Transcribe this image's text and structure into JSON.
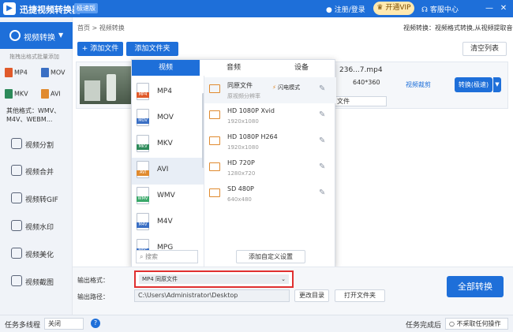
{
  "titlebar": {
    "app_title": "迅捷视频转换器",
    "edition_badge": "极速版",
    "login": "注册/登录",
    "vip": "开通VIP",
    "service": "客服中心",
    "minimize": "—",
    "close": "✕"
  },
  "sidebar": {
    "active_label": "视频转换",
    "hint": "拖拽出格式批量添加",
    "formats": [
      {
        "label": "MP4",
        "color": "#e05a2b"
      },
      {
        "label": "MOV",
        "color": "#3a6fc4"
      },
      {
        "label": "MKV",
        "color": "#2d8a5a"
      },
      {
        "label": "AVI",
        "color": "#e08a2e"
      }
    ],
    "others": "其他格式：WMV、M4V、WEBM...",
    "items": [
      {
        "label": "视频分割",
        "icon": "split-icon"
      },
      {
        "label": "视频合并",
        "icon": "merge-icon"
      },
      {
        "label": "视频转GIF",
        "icon": "gif-icon"
      },
      {
        "label": "视频水印",
        "icon": "watermark-icon"
      },
      {
        "label": "视频美化",
        "icon": "beautify-icon"
      },
      {
        "label": "视频截图",
        "icon": "screenshot-icon"
      }
    ]
  },
  "breadcrumb": "首页 > 视频转换",
  "top_desc": "视频转换：视频格式转换,从视频提取音频",
  "toolbar": {
    "add_file": "+ 添加文件",
    "add_folder": "添加文件夹",
    "clear_list": "清空列表"
  },
  "file": {
    "name": "236...7.mp4",
    "resolution": "640*360",
    "output_format": "文件",
    "crop": "视频裁剪",
    "convert": "转换(极速)"
  },
  "popup": {
    "tabs": [
      "视频",
      "音频",
      "设备"
    ],
    "formats": [
      {
        "label": "MP4",
        "color": "#e05a2b"
      },
      {
        "label": "MOV",
        "color": "#3a6fc4"
      },
      {
        "label": "MKV",
        "color": "#2d8a5a"
      },
      {
        "label": "AVI",
        "color": "#e08a2e"
      },
      {
        "label": "WMV",
        "color": "#3aa86a"
      },
      {
        "label": "M4V",
        "color": "#3a6fc4"
      },
      {
        "label": "MPG",
        "color": "#3a6fc4"
      }
    ],
    "search_placeholder": "搜索",
    "presets": [
      {
        "name": "同原文件",
        "sub": "原视频分辨率"
      },
      {
        "name": "HD 1080P Xvid",
        "sub": "1920x1080"
      },
      {
        "name": "HD 1080P H264",
        "sub": "1920x1080"
      },
      {
        "name": "HD 720P",
        "sub": "1280x720"
      },
      {
        "name": "SD 480P",
        "sub": "640x480"
      }
    ],
    "flash_mode": "闪电模式",
    "custom_add": "添加自定义设置"
  },
  "output": {
    "format_label": "输出格式：",
    "format_value": "MP4  同原文件",
    "path_label": "输出路径：",
    "path_value": "C:\\Users\\Administrator\\Desktop",
    "change_dir": "更改目录",
    "open_folder": "打开文件夹",
    "convert_all": "全部转换"
  },
  "status": {
    "multithread_label": "任务多线程",
    "multithread_value": "关闭",
    "help": "?",
    "after_label": "任务完成后",
    "after_value": "不采取任何操作"
  }
}
